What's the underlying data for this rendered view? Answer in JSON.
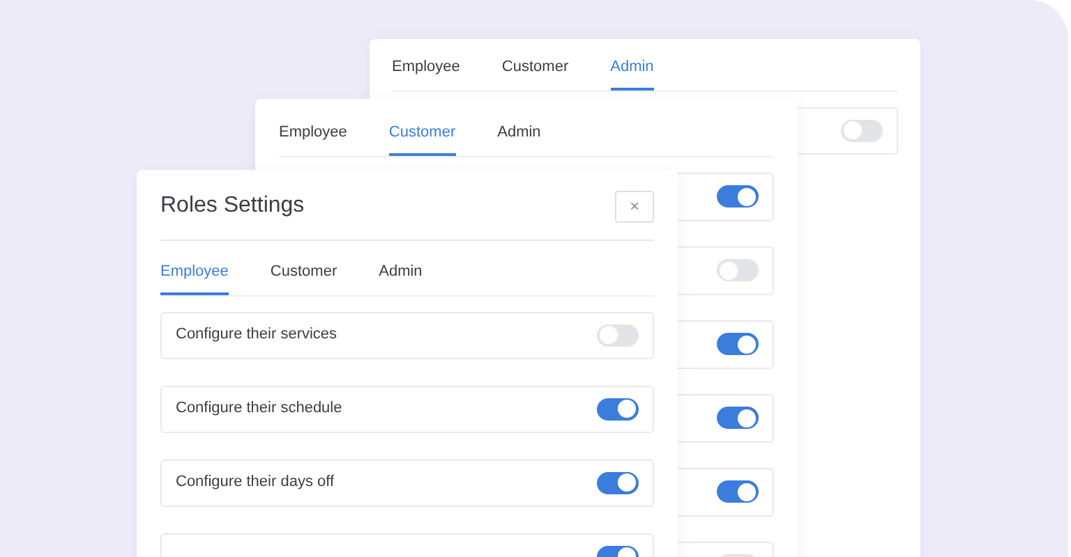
{
  "panels": [
    {
      "tabs": [
        {
          "label": "Employee",
          "selected": false
        },
        {
          "label": "Customer",
          "selected": false
        },
        {
          "label": "Admin",
          "selected": true
        }
      ],
      "rows": [
        {
          "on": false
        }
      ]
    },
    {
      "tabs": [
        {
          "label": "Employee",
          "selected": false
        },
        {
          "label": "Customer",
          "selected": true
        },
        {
          "label": "Admin",
          "selected": false
        }
      ],
      "rows": [
        {
          "on": true
        },
        {
          "on": false
        },
        {
          "on": true
        },
        {
          "on": true
        },
        {
          "on": true
        },
        {
          "on": false
        }
      ]
    },
    {
      "title": "Roles Settings",
      "close": "×",
      "tabs": [
        {
          "label": "Employee",
          "selected": true
        },
        {
          "label": "Customer",
          "selected": false
        },
        {
          "label": "Admin",
          "selected": false
        }
      ],
      "rows": [
        {
          "label": "Configure their services",
          "on": false
        },
        {
          "label": "Configure their schedule",
          "on": true
        },
        {
          "label": "Configure their days off",
          "on": true
        },
        {
          "on": true
        }
      ]
    }
  ]
}
